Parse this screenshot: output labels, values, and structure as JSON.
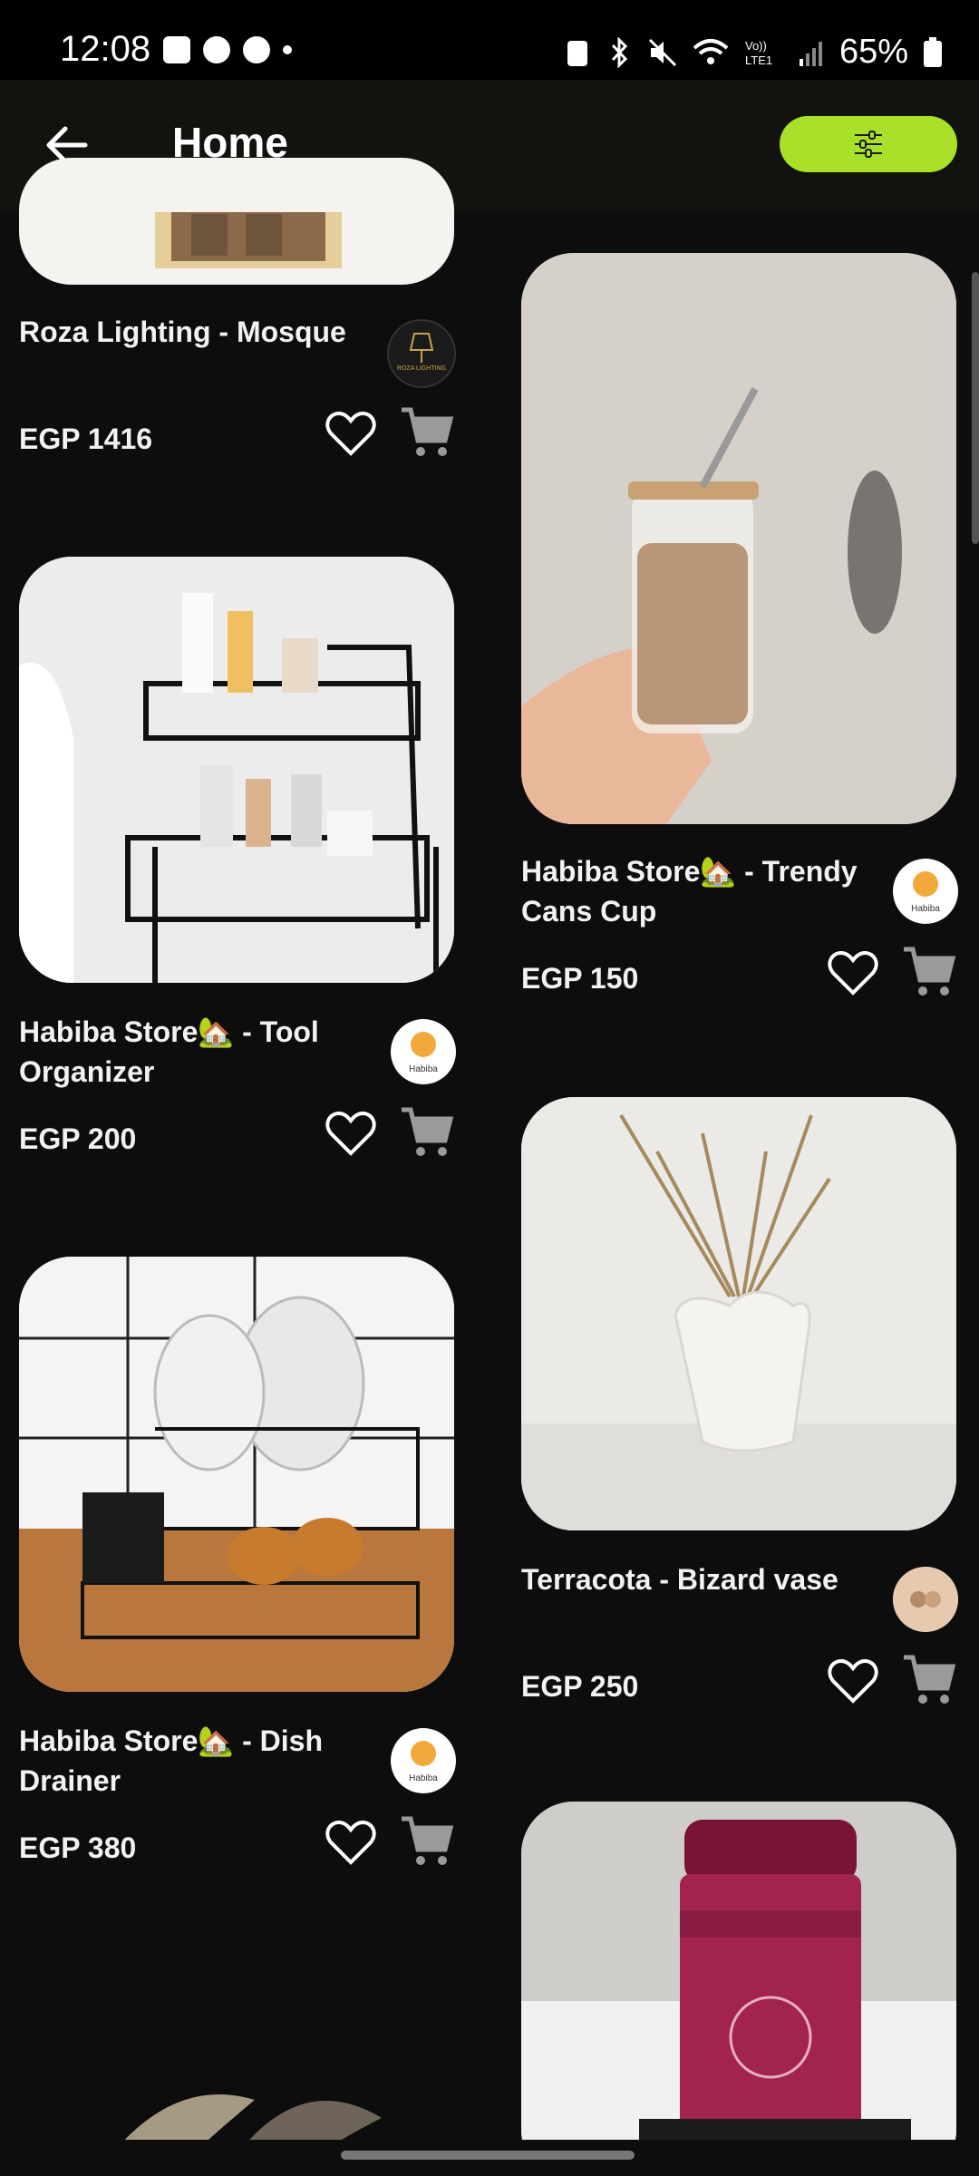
{
  "status_bar": {
    "time": "12:08",
    "battery": "65%"
  },
  "app_bar": {
    "title": "Home"
  },
  "colors": {
    "accent": "#a8e02a",
    "background": "#0d0d0d",
    "card_text": "#f2f2f2"
  },
  "products": [
    {
      "name": "Roza Lighting - Mosque",
      "price": "EGP 1416",
      "store_logo": "roza-lighting-logo"
    },
    {
      "name": "Habiba Store🏡 - Tool Organizer",
      "price": "EGP 200",
      "store_logo": "habiba-logo"
    },
    {
      "name": "Habiba Store🏡 - Dish Drainer",
      "price": "EGP 380",
      "store_logo": "habiba-logo"
    },
    {
      "name": "Habiba Store🏡 - Trendy Cans Cup",
      "price": "EGP 150",
      "store_logo": "habiba-logo"
    },
    {
      "name": "Terracota - Bizard vase",
      "price": "EGP 250",
      "store_logo": "terracota-logo"
    }
  ],
  "logo_text": {
    "roza": "ROZA LIGHTING",
    "habiba": "Habiba"
  }
}
